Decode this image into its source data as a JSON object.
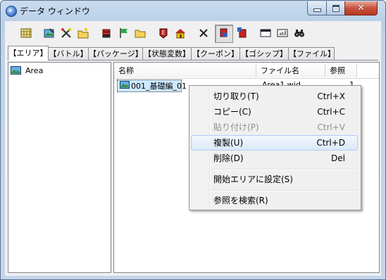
{
  "window": {
    "title": "データ ウィンドウ",
    "controls": {
      "minimize": "minimize",
      "maximize": "maximize",
      "close": "✕"
    }
  },
  "toolbar": {
    "buttons": [
      {
        "icon": "grid-icon",
        "pressed": false
      },
      {
        "icon": "map-edit-icon",
        "pressed": false
      },
      {
        "icon": "tools-icon",
        "pressed": false
      },
      {
        "icon": "new-folder-icon",
        "pressed": false
      },
      {
        "icon": "stack-icon",
        "pressed": false
      },
      {
        "icon": "flag-icon",
        "pressed": false
      },
      {
        "icon": "folder-icon",
        "pressed": false
      },
      {
        "icon": "event-icon",
        "pressed": false
      },
      {
        "icon": "house-icon",
        "pressed": false
      },
      {
        "icon": "delete-icon",
        "pressed": false
      },
      {
        "icon": "export-icon",
        "pressed": true
      },
      {
        "icon": "import-icon",
        "pressed": false
      },
      {
        "icon": "window-icon",
        "pressed": false
      },
      {
        "icon": "text-field-icon",
        "pressed": false
      },
      {
        "icon": "binoculars-icon",
        "pressed": false
      }
    ]
  },
  "tabs": [
    {
      "label": "【エリア】",
      "active": true
    },
    {
      "label": "【バトル】",
      "active": false
    },
    {
      "label": "【パッケージ】",
      "active": false
    },
    {
      "label": "【状態変数】",
      "active": false
    },
    {
      "label": "【クーポン】",
      "active": false
    },
    {
      "label": "【ゴシップ】",
      "active": false
    },
    {
      "label": "【ファイル】",
      "active": false
    }
  ],
  "tree": {
    "items": [
      {
        "label": "Area"
      }
    ]
  },
  "list": {
    "columns": [
      "名称",
      "ファイル名",
      "参照"
    ],
    "rows": [
      {
        "name": "001_基礎編_01",
        "file": "Area1.wid",
        "ref": "1"
      }
    ]
  },
  "context_menu": {
    "items": [
      {
        "label": "切り取り(T)",
        "shortcut": "Ctrl+X",
        "disabled": false,
        "hover": false
      },
      {
        "label": "コピー(C)",
        "shortcut": "Ctrl+C",
        "disabled": false,
        "hover": false
      },
      {
        "label": "貼り付け(P)",
        "shortcut": "Ctrl+V",
        "disabled": true,
        "hover": false
      },
      {
        "label": "複製(U)",
        "shortcut": "Ctrl+D",
        "disabled": false,
        "hover": true
      },
      {
        "label": "削除(D)",
        "shortcut": "Del",
        "disabled": false,
        "hover": false
      },
      {
        "label": "開始エリアに設定(S)",
        "shortcut": "",
        "disabled": false,
        "hover": false
      },
      {
        "label": "参照を検索(R)",
        "shortcut": "",
        "disabled": false,
        "hover": false
      }
    ]
  },
  "colors": {
    "selection": "#cde8ff",
    "hover_border": "#aecff7",
    "titlebar": "#bfd3ea",
    "close": "#c7533d"
  }
}
